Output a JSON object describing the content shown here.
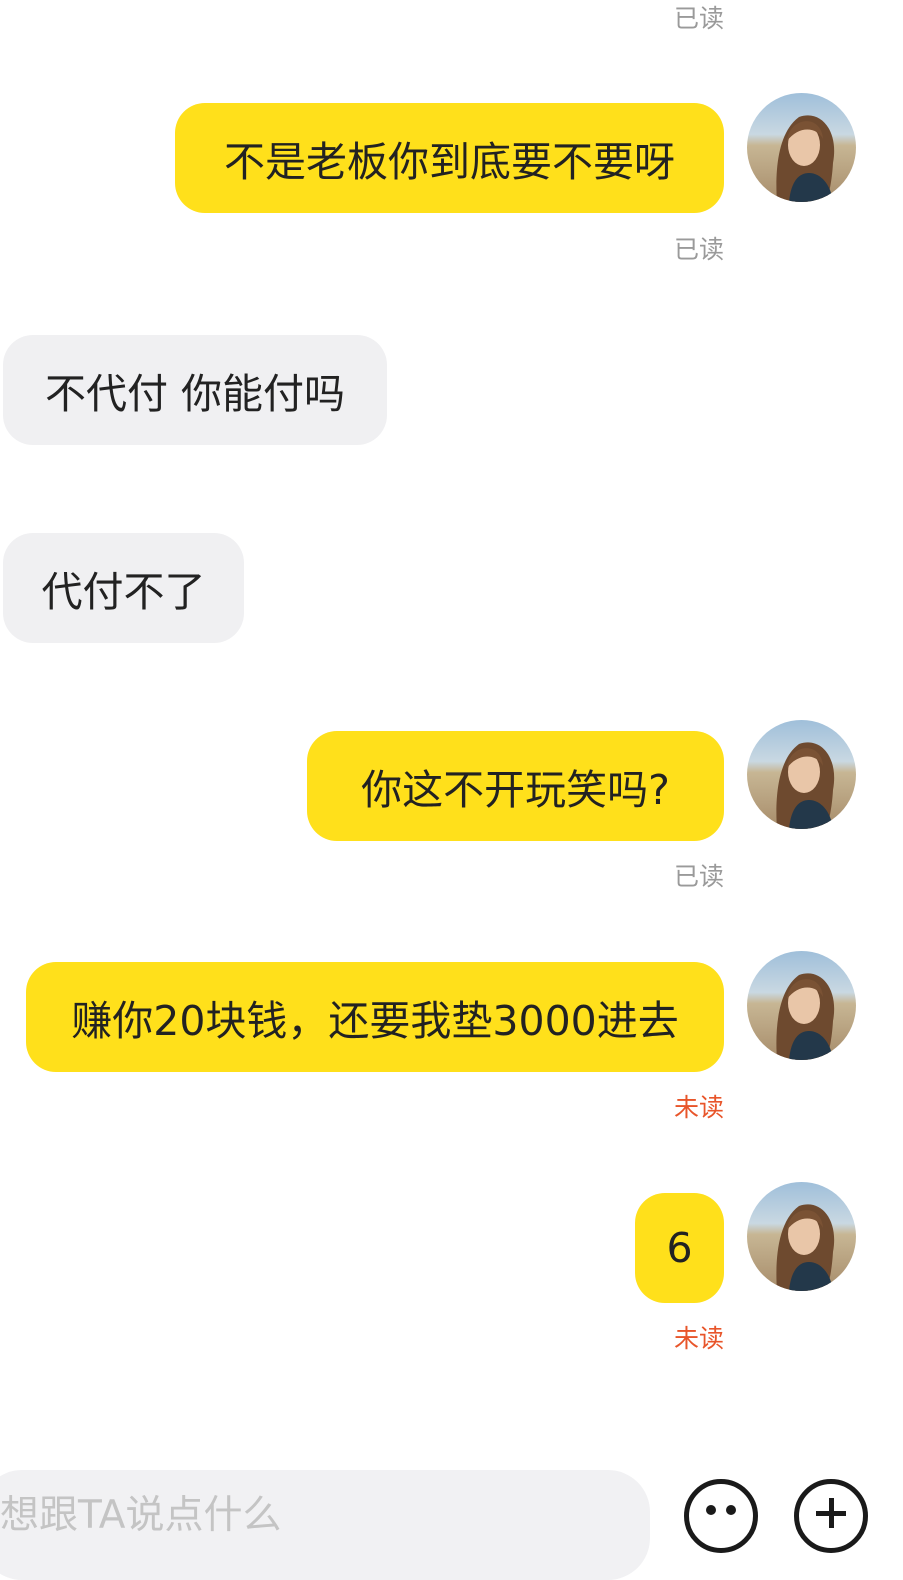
{
  "messages": [
    {
      "side": "mine",
      "text": "",
      "status": "已读",
      "status_type": "read"
    },
    {
      "side": "mine",
      "text": "不是老板你到底要不要呀",
      "status": "已读",
      "status_type": "read"
    },
    {
      "side": "theirs",
      "text": "不代付 你能付吗"
    },
    {
      "side": "theirs",
      "text": "代付不了"
    },
    {
      "side": "mine",
      "text": "你这不开玩笑吗?",
      "status": "已读",
      "status_type": "read"
    },
    {
      "side": "mine",
      "text": "赚你20块钱，还要我垫3000进去",
      "status": "未读",
      "status_type": "unread"
    },
    {
      "side": "mine",
      "text": "6",
      "status": "未读",
      "status_type": "unread"
    }
  ],
  "input": {
    "placeholder": "想跟TA说点什么"
  },
  "icons": {
    "emoji": "emoji-face-icon",
    "plus": "plus-circle-icon"
  },
  "colors": {
    "my_bubble": "#ffe01b",
    "their_bubble": "#f0f0f2",
    "read_status": "#9a9a9a",
    "unread_status": "#e8552a"
  }
}
